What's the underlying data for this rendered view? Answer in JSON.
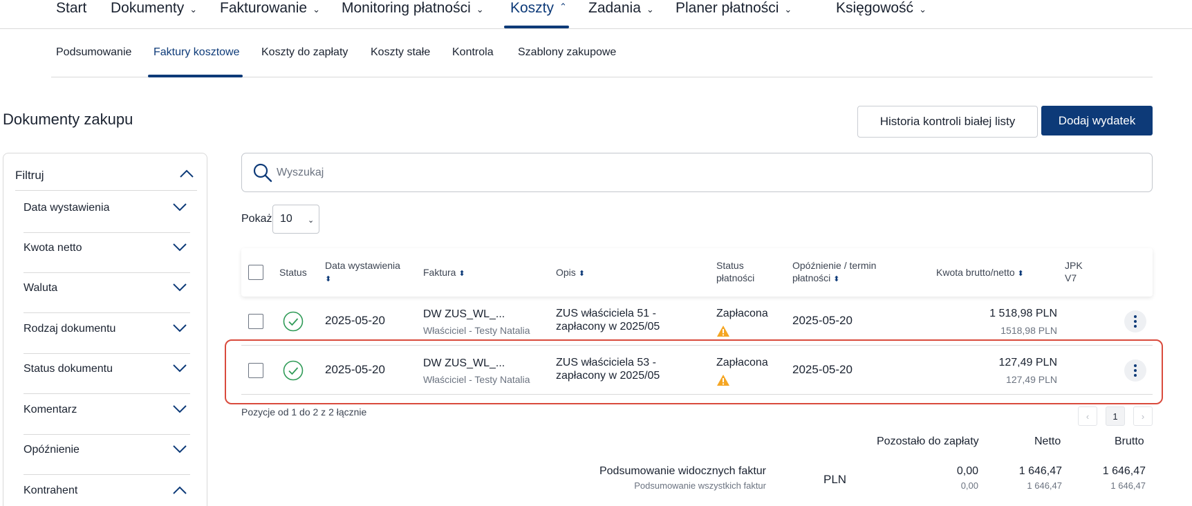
{
  "top_nav": {
    "items": [
      {
        "label": "Start",
        "has_chevron": false
      },
      {
        "label": "Dokumenty",
        "has_chevron": true
      },
      {
        "label": "Fakturowanie",
        "has_chevron": true
      },
      {
        "label": "Monitoring płatności",
        "has_chevron": true
      },
      {
        "label": "Koszty",
        "has_chevron": true,
        "active": true
      },
      {
        "label": "Zadania",
        "has_chevron": true
      },
      {
        "label": "Planer płatności",
        "has_chevron": true
      },
      {
        "label": "Księgowość",
        "has_chevron": true
      }
    ]
  },
  "sub_nav": {
    "items": [
      {
        "label": "Podsumowanie"
      },
      {
        "label": "Faktury kosztowe",
        "active": true
      },
      {
        "label": "Koszty do zapłaty"
      },
      {
        "label": "Koszty stałe"
      },
      {
        "label": "Kontrola"
      },
      {
        "label": "Szablony zakupowe"
      }
    ]
  },
  "page": {
    "title": "Dokumenty zakupu",
    "history_button": "Historia kontroli białej listy",
    "add_button": "Dodaj wydatek"
  },
  "filters": {
    "title": "Filtruj",
    "items": [
      {
        "label": "Data wystawienia",
        "expanded": false
      },
      {
        "label": "Kwota netto",
        "expanded": false
      },
      {
        "label": "Waluta",
        "expanded": false
      },
      {
        "label": "Rodzaj dokumentu",
        "expanded": false
      },
      {
        "label": "Status dokumentu",
        "expanded": false
      },
      {
        "label": "Komentarz",
        "expanded": false
      },
      {
        "label": "Opóźnienie",
        "expanded": false
      },
      {
        "label": "Kontrahent",
        "expanded": true
      }
    ]
  },
  "search": {
    "placeholder": "Wyszukaj",
    "value": ""
  },
  "page_size": {
    "label": "Pokaż",
    "value": "10"
  },
  "table": {
    "headers": {
      "status": "Status",
      "date": "Data wystawienia",
      "invoice": "Faktura",
      "desc": "Opis",
      "pay_status_1": "Status",
      "pay_status_2": "płatności",
      "delay_1": "Opóźnienie / termin",
      "delay_2": "płatności",
      "amount": "Kwota brutto/netto",
      "jpk_1": "JPK",
      "jpk_2": "V7"
    },
    "rows": [
      {
        "date": "2025-05-20",
        "invoice": "DW ZUS_WL_...",
        "invoice_sub": "Właściciel - Testy Natalia",
        "desc_1": "ZUS właściciela 51 -",
        "desc_2": "zapłacony w 2025/05",
        "pay_status": "Zapłacona",
        "due": "2025-05-20",
        "gross": "1 518,98 PLN",
        "net": "1518,98 PLN"
      },
      {
        "date": "2025-05-20",
        "invoice": "DW ZUS_WL_...",
        "invoice_sub": "Właściciel - Testy Natalia",
        "desc_1": "ZUS właściciela 53 -",
        "desc_2": "zapłacony w 2025/05",
        "pay_status": "Zapłacona",
        "due": "2025-05-20",
        "gross": "127,49 PLN",
        "net": "127,49 PLN"
      }
    ],
    "footer": "Pozycje od 1 do 2 z 2 łącznie"
  },
  "pager": {
    "prev": "‹",
    "page": "1",
    "next": "›"
  },
  "summary": {
    "h_remaining": "Pozostało do zapłaty",
    "h_net": "Netto",
    "h_gross": "Brutto",
    "visible_label": "Podsumowanie widocznych faktur",
    "all_label": "Podsumowanie wszystkich faktur",
    "currency": "PLN",
    "visible_remaining": "0,00",
    "visible_net": "1 646,47",
    "visible_gross": "1 646,47",
    "all_remaining": "0,00",
    "all_net": "1 646,47",
    "all_gross": "1 646,47"
  },
  "colors": {
    "primary": "#0d3a78",
    "ok": "#2e9a56",
    "warn": "#f5a623",
    "highlight": "#d94a3c"
  }
}
